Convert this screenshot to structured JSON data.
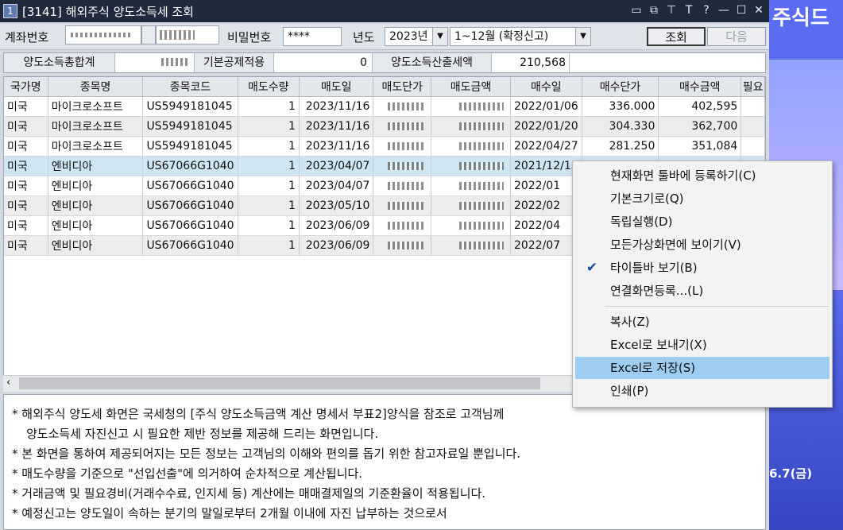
{
  "window": {
    "number": "1",
    "title": "[3141] 해외주식 양도소득세 조회",
    "icons": [
      "restore-layout-icon",
      "copy-window-icon",
      "pin-icon",
      "font-icon",
      "help-icon",
      "minimize-icon",
      "maximize-icon",
      "close-icon"
    ]
  },
  "filters": {
    "account_label": "계좌번호",
    "password_label": "비밀번호",
    "password_value": "****",
    "year_label": "년도",
    "year_value": "2023년",
    "period_value": "1~12월 (확정신고)",
    "search_button": "조회",
    "next_button": "다음"
  },
  "summary": {
    "total_label": "양도소득총합계",
    "deduction_label": "기본공제적용",
    "deduction_value": "0",
    "tax_label": "양도소득산출세액",
    "tax_value": "210,568"
  },
  "table": {
    "columns": [
      "국가명",
      "종목명",
      "종목코드",
      "매도수량",
      "매도일",
      "매도단가",
      "매도금액",
      "매수일",
      "매수단가",
      "매수금액",
      "필요"
    ],
    "rows": [
      {
        "country": "미국",
        "name": "마이크로소프트",
        "code": "US5949181045",
        "qty": "1",
        "sell_date": "2023/11/16",
        "buy_date": "2022/01/06",
        "buy_price": "336.000",
        "buy_amount": "402,595"
      },
      {
        "country": "미국",
        "name": "마이크로소프트",
        "code": "US5949181045",
        "qty": "1",
        "sell_date": "2023/11/16",
        "buy_date": "2022/01/20",
        "buy_price": "304.330",
        "buy_amount": "362,700"
      },
      {
        "country": "미국",
        "name": "마이크로소프트",
        "code": "US5949181045",
        "qty": "1",
        "sell_date": "2023/11/16",
        "buy_date": "2022/04/27",
        "buy_price": "281.250",
        "buy_amount": "351,084"
      },
      {
        "country": "미국",
        "name": "엔비디아",
        "code": "US67066G1040",
        "qty": "1",
        "sell_date": "2023/04/07",
        "buy_date": "2021/12/15",
        "buy_price": "",
        "buy_amount": ""
      },
      {
        "country": "미국",
        "name": "엔비디아",
        "code": "US67066G1040",
        "qty": "1",
        "sell_date": "2023/04/07",
        "buy_date": "2022/01",
        "buy_price": "",
        "buy_amount": ""
      },
      {
        "country": "미국",
        "name": "엔비디아",
        "code": "US67066G1040",
        "qty": "1",
        "sell_date": "2023/05/10",
        "buy_date": "2022/02",
        "buy_price": "",
        "buy_amount": ""
      },
      {
        "country": "미국",
        "name": "엔비디아",
        "code": "US67066G1040",
        "qty": "1",
        "sell_date": "2023/06/09",
        "buy_date": "2022/04",
        "buy_price": "",
        "buy_amount": ""
      },
      {
        "country": "미국",
        "name": "엔비디아",
        "code": "US67066G1040",
        "qty": "1",
        "sell_date": "2023/06/09",
        "buy_date": "2022/07",
        "buy_price": "",
        "buy_amount": ""
      }
    ]
  },
  "notes": [
    "* 해외주식 양도세 화면은 국세청의 [주식 양도소득금액 계산 명세서 부표2]양식을 참조로 고객님께",
    "  양도소득세 자진신고 시 필요한 제반 정보를 제공해 드리는 화면입니다.",
    "* 본 화면을 통하여 제공되어지는 모든 정보는 고객님의 이해와 편의를 돕기 위한 참고자료일 뿐입니다.",
    "* 매도수량을 기준으로 \"선입선출\"에 의거하여 순차적으로 계산됩니다.",
    "* 거래금액 및 필요경비(거래수수료, 인지세 등) 계산에는 매매결제일의 기준환율이 적용됩니다.",
    "* 예정신고는 양도일이 속하는 분기의 말일로부터 2개월 이내에 자진 납부하는 것으로서"
  ],
  "context_menu": {
    "items": [
      {
        "label": "현재화면 툴바에 등록하기(C)",
        "checked": false
      },
      {
        "label": "기본크기로(Q)",
        "checked": false
      },
      {
        "label": "독립실행(D)",
        "checked": false
      },
      {
        "label": "모든가상화면에 보이기(V)",
        "checked": false
      },
      {
        "label": "타이틀바 보기(B)",
        "checked": true
      },
      {
        "label": "연결화면등록...(L)",
        "checked": false
      },
      {
        "label": "복사(Z)",
        "checked": false
      },
      {
        "label": "Excel로 보내기(X)",
        "checked": false
      },
      {
        "label": "Excel로 저장(S)",
        "checked": false,
        "highlighted": true
      },
      {
        "label": "인쇄(P)",
        "checked": false
      }
    ]
  },
  "ad": {
    "top_text": "주식드",
    "bottom_text": "6.7(금)"
  }
}
